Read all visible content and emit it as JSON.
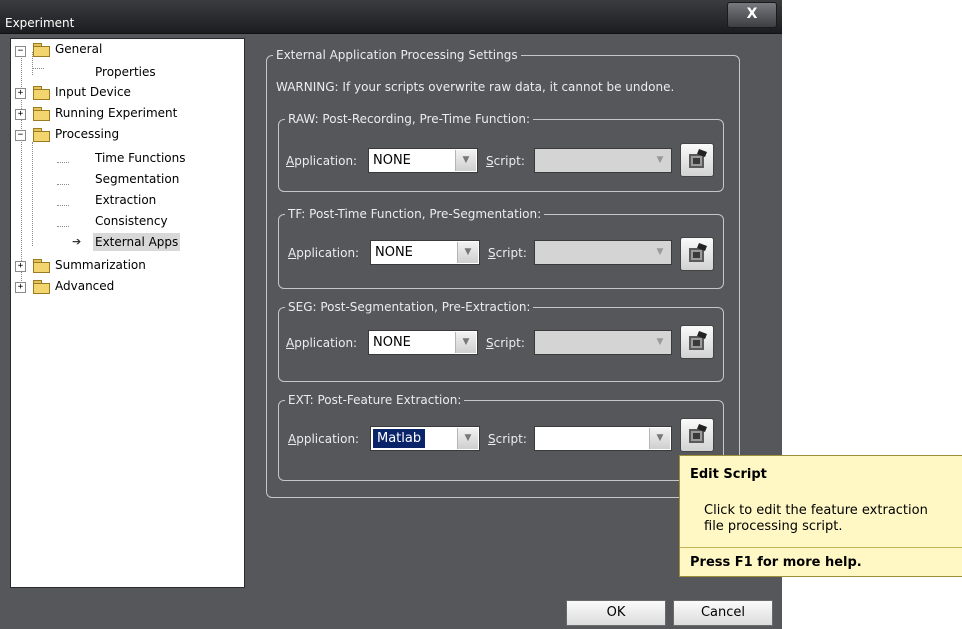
{
  "window": {
    "title": "Experiment",
    "close_label": "X"
  },
  "tree": {
    "items": [
      {
        "label": "General"
      },
      {
        "label": "Properties"
      },
      {
        "label": "Input Device"
      },
      {
        "label": "Running Experiment"
      },
      {
        "label": "Processing"
      },
      {
        "label": "Time Functions"
      },
      {
        "label": "Segmentation"
      },
      {
        "label": "Extraction"
      },
      {
        "label": "Consistency"
      },
      {
        "label": "External Apps"
      },
      {
        "label": "Summarization"
      },
      {
        "label": "Advanced"
      }
    ],
    "selected": "External Apps"
  },
  "main": {
    "group_title": "External Application Processing Settings",
    "warning": "WARNING: If your scripts overwrite raw data, it cannot be undone.",
    "application_mnemonic": "A",
    "application_rest": "pplication:",
    "script_mnemonic": "S",
    "script_rest": "cript:",
    "sections": [
      {
        "title": "RAW: Post-Recording, Pre-Time Function:",
        "application": "NONE",
        "script": ""
      },
      {
        "title": "TF: Post-Time Function, Pre-Segmentation:",
        "application": "NONE",
        "script": ""
      },
      {
        "title": "SEG: Post-Segmentation, Pre-Extraction:",
        "application": "NONE",
        "script": ""
      },
      {
        "title": "EXT: Post-Feature Extraction:",
        "application": "Matlab",
        "script": ""
      }
    ]
  },
  "buttons": {
    "ok": "OK",
    "cancel": "Cancel"
  },
  "tooltip": {
    "title": "Edit Script",
    "line1": "Click to edit the feature extraction",
    "line2": "file processing script.",
    "help": "Press F1 for more help."
  },
  "colors": {
    "window_bg": "#55575b",
    "tooltip_bg": "#fff8c4",
    "selection": "#0a246a"
  }
}
